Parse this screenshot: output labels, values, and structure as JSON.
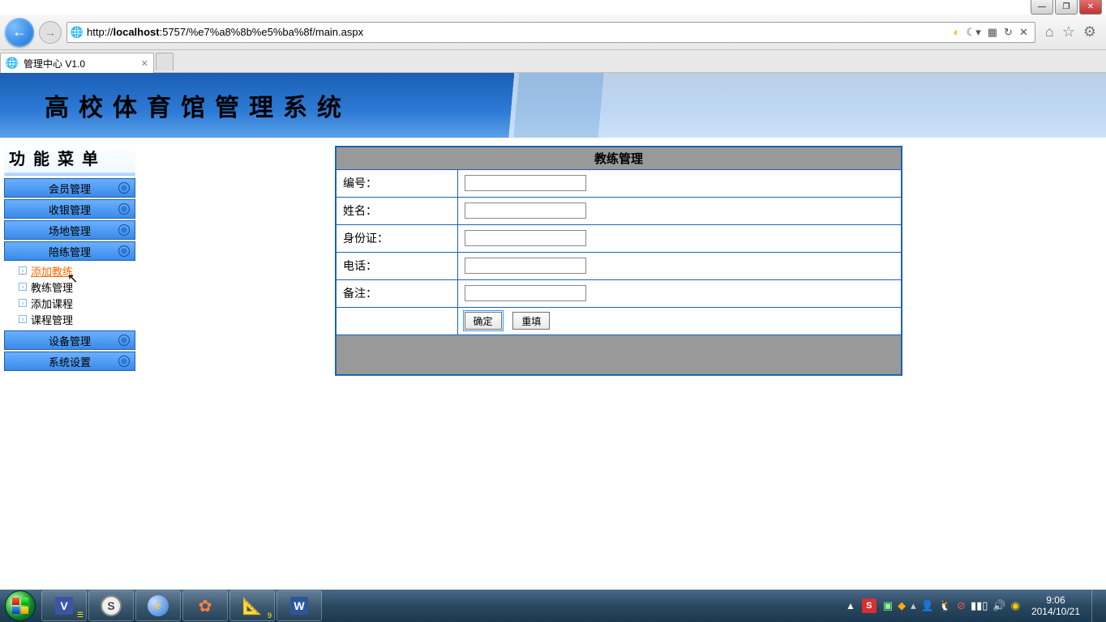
{
  "window": {
    "url_pre": "http://",
    "url_host": "localhost",
    "url_path": ":5757/%e7%a8%8b%e5%ba%8f/main.aspx"
  },
  "tab": {
    "title": "管理中心 V1.0"
  },
  "banner": {
    "title": "高校体育馆管理系统"
  },
  "sidebar": {
    "title": "功能菜单",
    "items": [
      {
        "label": "会员管理"
      },
      {
        "label": "收银管理"
      },
      {
        "label": "场地管理"
      },
      {
        "label": "陪练管理"
      },
      {
        "label": "设备管理"
      },
      {
        "label": "系统设置"
      }
    ],
    "submenu": [
      {
        "label": "添加教练",
        "active": true
      },
      {
        "label": "教练管理"
      },
      {
        "label": "添加课程"
      },
      {
        "label": "课程管理"
      }
    ]
  },
  "form": {
    "title": "教练管理",
    "rows": [
      {
        "label": "编号："
      },
      {
        "label": "姓名："
      },
      {
        "label": "身份证："
      },
      {
        "label": "电话："
      },
      {
        "label": "备注："
      }
    ],
    "submit": "确定",
    "reset": "重填"
  },
  "tray": {
    "sogou": "S",
    "time": "9:06",
    "date": "2014/10/21"
  }
}
